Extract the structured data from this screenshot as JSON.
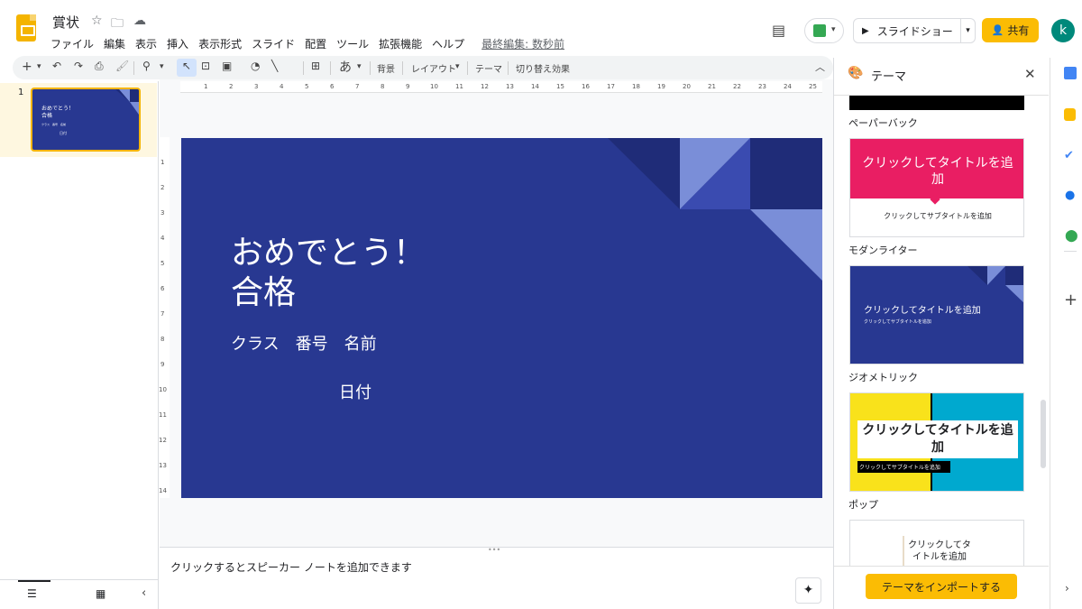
{
  "doc": {
    "title": "賞状"
  },
  "menu": {
    "items": [
      "ファイル",
      "編集",
      "表示",
      "挿入",
      "表示形式",
      "スライド",
      "配置",
      "ツール",
      "拡張機能",
      "ヘルプ"
    ],
    "last_edit": "最終編集: 数秒前"
  },
  "header": {
    "slideshow": "スライドショー",
    "share": "共有",
    "avatar": "k"
  },
  "toolbar": {
    "background": "背景",
    "layout": "レイアウト",
    "theme": "テーマ",
    "transition": "切り替え効果",
    "ime": "あ"
  },
  "ruler": {
    "h": [
      "1",
      "2",
      "3",
      "4",
      "5",
      "6",
      "7",
      "8",
      "9",
      "10",
      "11",
      "12",
      "13",
      "14",
      "15",
      "16",
      "17",
      "18",
      "19",
      "20",
      "21",
      "22",
      "23",
      "24",
      "25"
    ],
    "v": [
      "1",
      "2",
      "3",
      "4",
      "5",
      "6",
      "7",
      "8",
      "9",
      "10",
      "11",
      "12",
      "13",
      "14"
    ]
  },
  "filmstrip": {
    "slide_number": "1"
  },
  "slide": {
    "title_line1": "おめでとう！",
    "title_line2": "合格",
    "subtitle": "クラス　番号　名前",
    "date": "日付",
    "bg": "#283891"
  },
  "notes": {
    "placeholder": "クリックするとスピーカー ノートを追加できます"
  },
  "theme_panel": {
    "title": "テーマ",
    "themes": [
      {
        "name": "ペーパーバック"
      },
      {
        "name": "モダンライター",
        "card_title": "クリックしてタイトルを追加",
        "card_subtitle": "クリックしてサブタイトルを追加"
      },
      {
        "name": "ジオメトリック",
        "card_title": "クリックしてタイトルを追加",
        "card_subtitle": "クリックしてサブタイトルを追加"
      },
      {
        "name": "ポップ",
        "card_title": "クリックしてタイトルを追加",
        "card_subtitle": "クリックしてサブタイトルを追加"
      },
      {
        "card_title": "クリックしてタイトルを追加"
      }
    ],
    "import": "テーマをインポートする"
  },
  "colors": {
    "accent": "#fbbc04",
    "slide_bg": "#283891",
    "pink": "#e91e63"
  }
}
